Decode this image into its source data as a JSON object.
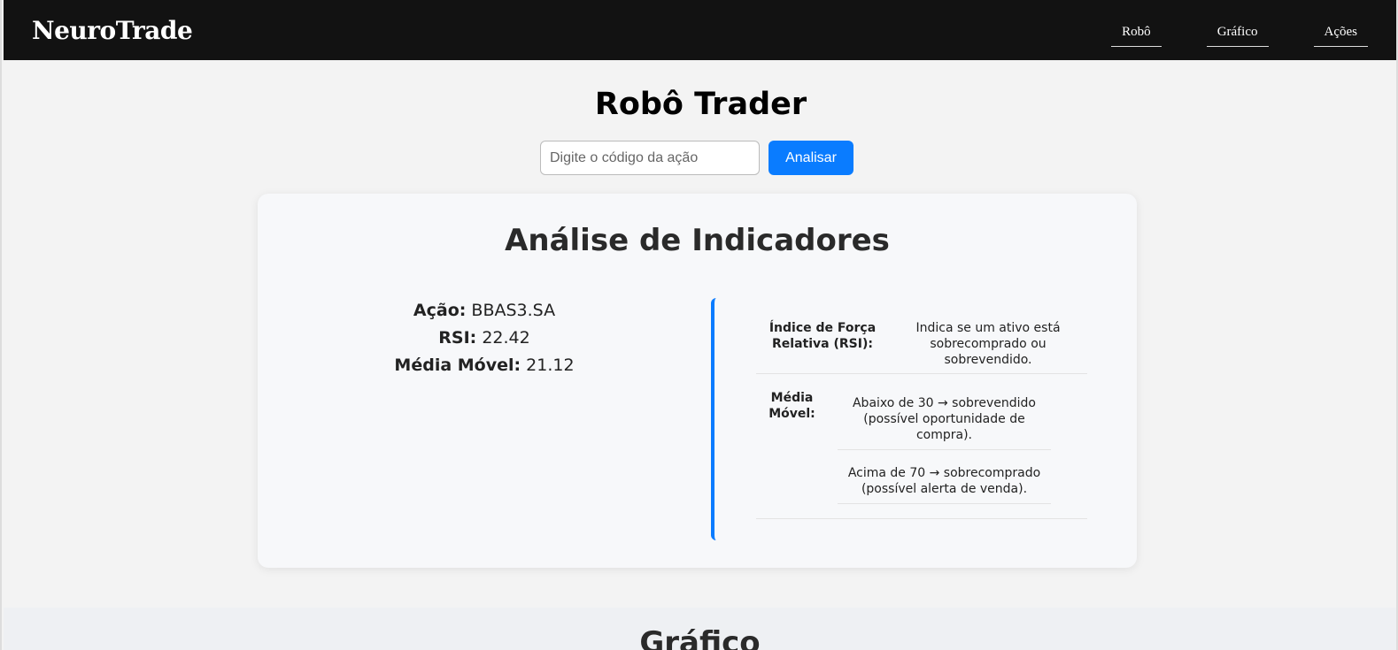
{
  "navbar": {
    "brand": "NeuroTrade",
    "links": [
      "Robô",
      "Gráfico",
      "Ações"
    ]
  },
  "hero": {
    "title": "Robô Trader",
    "search_placeholder": "Digite o código da ação",
    "analyze_label": "Analisar"
  },
  "card": {
    "title": "Análise de Indicadores",
    "values": [
      {
        "label": "Ação:",
        "value": "BBAS3.SA"
      },
      {
        "label": "RSI:",
        "value": "22.42"
      },
      {
        "label": "Média Móvel:",
        "value": "21.12"
      }
    ],
    "info": {
      "rsi_label_1": "Índice de Força",
      "rsi_label_2": "Relativa (RSI):",
      "rsi_desc_1": "Indica se um ativo está",
      "rsi_desc_2": "sobrecomprado ou",
      "rsi_desc_3": "sobrevendido.",
      "mm_label_1": "Média",
      "mm_label_2": "Móvel:",
      "below_1": "Abaixo de 30 → sobrevendido",
      "below_2": "(possível oportunidade de",
      "below_3": "compra).",
      "above_1": "Acima de 70 → sobrecomprado",
      "above_2": "(possível alerta de venda)."
    }
  },
  "bottom": {
    "title": "Gráfico"
  },
  "colors": {
    "accent": "#0a7cff",
    "navbar_bg": "#121212"
  }
}
